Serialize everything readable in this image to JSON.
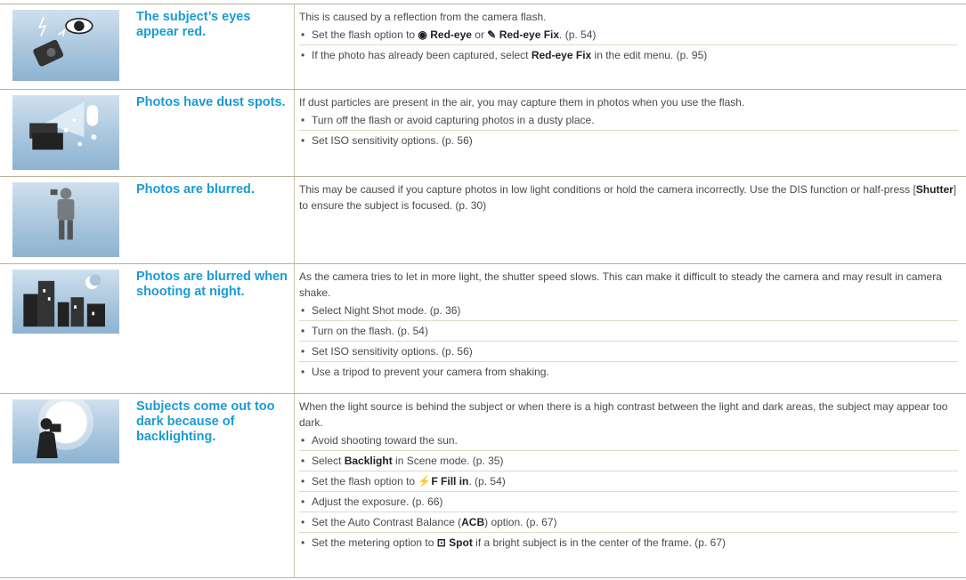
{
  "rows": [
    {
      "title": "The subject’s eyes appear red.",
      "intro": "This is caused by a reflection from the camera flash.",
      "b1_pre": "Set the flash option to ",
      "b1_icon1": "◉",
      "b1_bold1": "Red-eye",
      "b1_mid": " or ",
      "b1_icon2": "✎",
      "b1_bold2": "Red-eye Fix",
      "b1_post": ". (p. 54)",
      "b2_pre": "If the photo has already been captured, select ",
      "b2_bold": "Red-eye Fix",
      "b2_post": " in the edit menu. (p. 95)"
    },
    {
      "title": "Photos have dust spots.",
      "intro": "If dust particles are present in the air, you may capture them in photos when you use the flash.",
      "b1": "Turn off the flash or avoid capturing photos in a dusty place.",
      "b2": "Set ISO sensitivity options. (p. 56)"
    },
    {
      "title": "Photos are blurred.",
      "intro_pre": "This may be caused if you capture photos in low light conditions or hold the camera incorrectly. Use the DIS function or half-press [",
      "intro_bold": "Shutter",
      "intro_post": "] to ensure the subject is focused. (p. 30)"
    },
    {
      "title": "Photos are blurred when shooting at night.",
      "intro": "As the camera tries to let in more light, the shutter speed slows. This can make it difficult to steady the camera and may result in camera shake.",
      "b1": "Select Night Shot mode. (p. 36)",
      "b2": "Turn on the flash. (p. 54)",
      "b3": "Set ISO sensitivity options. (p. 56)",
      "b4": "Use a tripod to prevent your camera from shaking."
    },
    {
      "title": "Subjects come out too dark because of backlighting.",
      "intro": "When the light source is behind the subject or when there is a high contrast between the light and dark areas, the subject may appear too dark.",
      "b1": "Avoid shooting toward the sun.",
      "b2_pre": "Select ",
      "b2_bold": "Backlight",
      "b2_post": " in Scene mode. (p. 35)",
      "b3_pre": "Set the flash option to ",
      "b3_icon": "⚡F",
      "b3_bold": "Fill in",
      "b3_post": ". (p. 54)",
      "b4": "Adjust the exposure. (p. 66)",
      "b5_pre": "Set the Auto Contrast Balance (",
      "b5_bold": "ACB",
      "b5_post": ") option. (p. 67)",
      "b6_pre": "Set the metering option to ",
      "b6_icon": "⊡",
      "b6_bold": "Spot",
      "b6_post": " if a bright subject is in the center of the frame. (p. 67)"
    }
  ],
  "colors": {
    "title": "#1a9bd3",
    "rule": "#b7b39a",
    "text": "#4a4a4a"
  }
}
